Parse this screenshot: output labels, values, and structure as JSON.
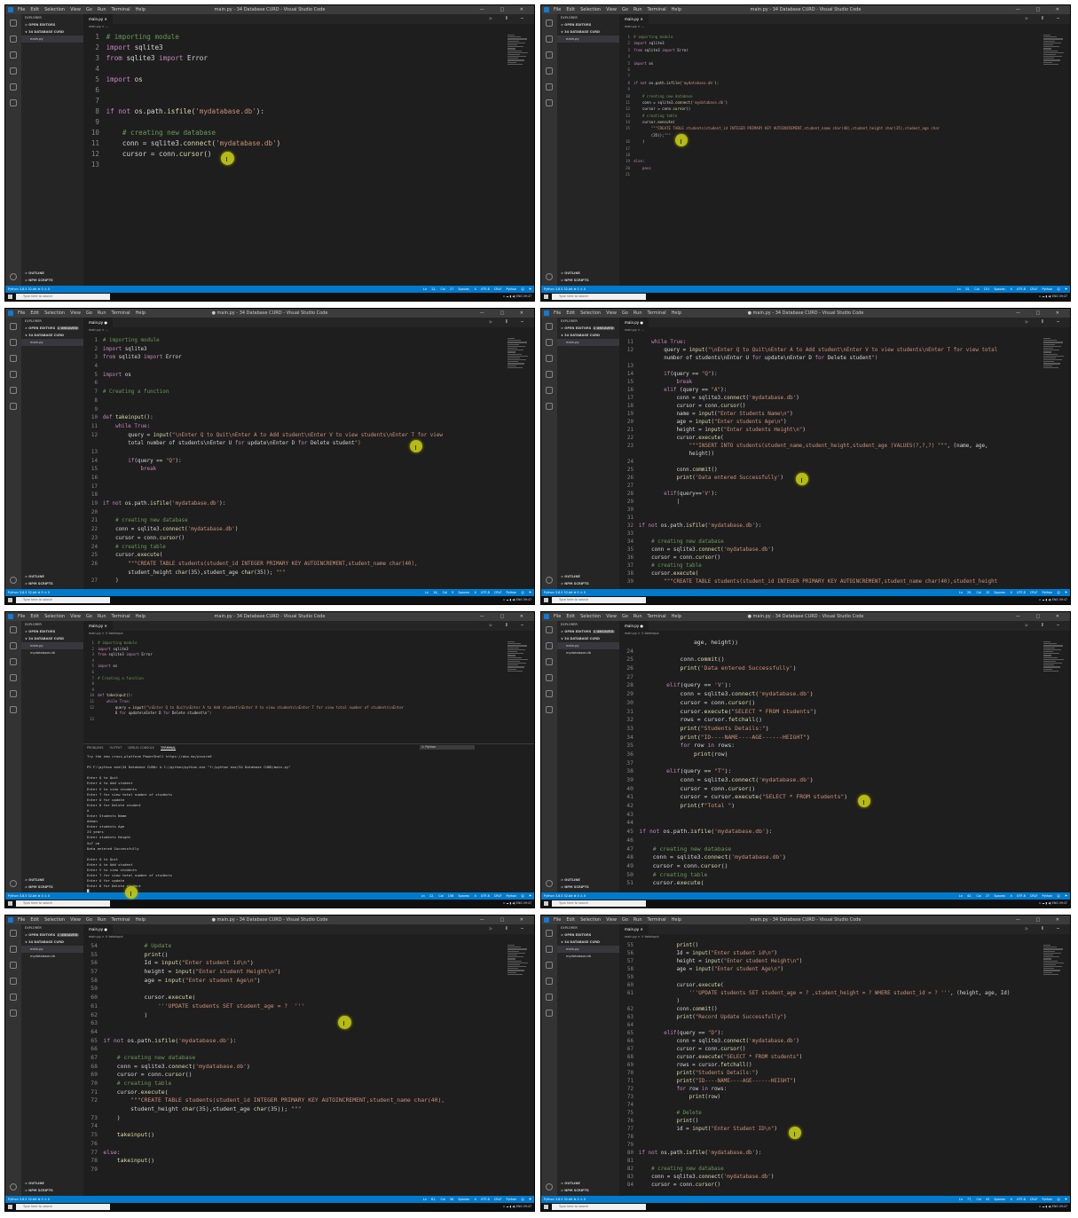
{
  "window": {
    "menu": [
      "File",
      "Edit",
      "Selection",
      "View",
      "Go",
      "Run",
      "Terminal",
      "Help"
    ],
    "title_saved": "main.py - 34 Database CURD - Visual Studio Code",
    "title_unsaved": "● main.py - 34 Database CURD - Visual Studio Code",
    "controls": "— □ ✕"
  },
  "sidebar": {
    "explorer": "EXPLORER",
    "open_editors": "> OPEN EDITORS",
    "unsaved_badge": "1 UNSAVED",
    "folder": "∨ 34 DATABASE CURD",
    "file_main": "main.py",
    "file_db": "mydatabase.db",
    "outline": "> OUTLINE",
    "npm": "> NPM SCRIPTS"
  },
  "tabs": {
    "main": "main.py",
    "crumb": "main.py > ...",
    "crumb_fn": "main.py > ⊙ takeinput"
  },
  "status": {
    "left": "Python 3.8.5 32-bit   ⊗ 0 ⚠ 0",
    "right_items": [
      "Ln 12, Col 27",
      "Ln 15, Col 151",
      "Ln 16, Col 9",
      "Ln 29, Col 15",
      "Ln 12, Col 156",
      "Ln 42, Col 27",
      "Ln 61, Col 56",
      "Ln 77, Col 43"
    ],
    "right_tail": "Spaces: 4  UTF-8  CRLF  Python  ☺ ⚑"
  },
  "taskbar": {
    "search": "Type here to search",
    "tray": "∧ ☁ ▮ ◀) ENG  09:47"
  },
  "terminal": {
    "tabs": [
      "PROBLEMS",
      "OUTPUT",
      "DEBUG CONSOLE",
      "TERMINAL"
    ],
    "selector": "1: Python",
    "output": [
      "Try the new cross-platform PowerShell https://aka.ms/pscore6",
      "",
      "PS F:\\python exe\\34 Database CURD> & C:/python/python.exe \"f:/python exe/34 Database CURD/main.py\"",
      "",
      "Enter Q to Quit",
      "Enter A to Add student",
      "Enter V to view students",
      "Enter T for view total number of students",
      "Enter U for update",
      "Enter D for Delete student",
      "A",
      "Enter Students Name",
      "Adnan",
      "Enter students Age",
      "23 years",
      "Enter students Height",
      "5x7 cm",
      "Data entered Successfully",
      "",
      "Enter Q to Quit",
      "Enter A to Add student",
      "Enter V to view students",
      "Enter T for view total number of students",
      "Enter U for update",
      "Enter D for Delete student",
      "█"
    ]
  },
  "panels": [
    {
      "lines": [
        {
          "n": "1",
          "t": "# importing module"
        },
        {
          "n": "2",
          "t": "import sqlite3"
        },
        {
          "n": "3",
          "t": "from sqlite3 import Error"
        },
        {
          "n": "4",
          "t": ""
        },
        {
          "n": "5",
          "t": "import os"
        },
        {
          "n": "6",
          "t": ""
        },
        {
          "n": "7",
          "t": ""
        },
        {
          "n": "8",
          "t": "if not os.path.isfile('mydatabase.db'):"
        },
        {
          "n": "9",
          "t": ""
        },
        {
          "n": "10",
          "t": "    # creating new database"
        },
        {
          "n": "11",
          "t": "    conn = sqlite3.connect('mydatabase.db')"
        },
        {
          "n": "12",
          "t": "    cursor = conn.cursor()"
        },
        {
          "n": "13",
          "t": ""
        }
      ]
    },
    {
      "lines": [
        {
          "n": "1",
          "t": "# importing module"
        },
        {
          "n": "2",
          "t": "import sqlite3"
        },
        {
          "n": "3",
          "t": "from sqlite3 import Error"
        },
        {
          "n": "4",
          "t": ""
        },
        {
          "n": "5",
          "t": "import os"
        },
        {
          "n": "6",
          "t": ""
        },
        {
          "n": "7",
          "t": ""
        },
        {
          "n": "8",
          "t": "if not os.path.isfile('mydatabase.db'):"
        },
        {
          "n": "9",
          "t": ""
        },
        {
          "n": "10",
          "t": "    # creating new database"
        },
        {
          "n": "11",
          "t": "    conn = sqlite3.connect('mydatabase.db')"
        },
        {
          "n": "12",
          "t": "    cursor = conn.cursor()"
        },
        {
          "n": "13",
          "t": "    # creating table"
        },
        {
          "n": "14",
          "t": "    cursor.execute("
        },
        {
          "n": "15",
          "t": "        \"\"\"CREATE TABLE students(student_id INTEGER PRIMARY KEY AUTOINCREMENT,student_name char(40),student_height char(35),student_age char"
        },
        {
          "n": "",
          "t": "        (35));\"\"\""
        },
        {
          "n": "16",
          "t": "    )"
        },
        {
          "n": "17",
          "t": ""
        },
        {
          "n": "18",
          "t": ""
        },
        {
          "n": "19",
          "t": "else:"
        },
        {
          "n": "20",
          "t": "    pass"
        },
        {
          "n": "21",
          "t": ""
        }
      ]
    },
    {
      "lines": [
        {
          "n": "1",
          "t": "# importing module"
        },
        {
          "n": "2",
          "t": "import sqlite3"
        },
        {
          "n": "3",
          "t": "from sqlite3 import Error"
        },
        {
          "n": "4",
          "t": ""
        },
        {
          "n": "5",
          "t": "import os"
        },
        {
          "n": "6",
          "t": ""
        },
        {
          "n": "7",
          "t": "# Creating a function"
        },
        {
          "n": "8",
          "t": ""
        },
        {
          "n": "9",
          "t": ""
        },
        {
          "n": "10",
          "t": "def takeinput():"
        },
        {
          "n": "11",
          "t": "    while True:"
        },
        {
          "n": "12",
          "t": "        query = input(\"\\nEnter Q to Quit\\nEnter A to Add student\\nEnter V to view students\\nEnter T for view"
        },
        {
          "n": "",
          "t": "        total number of students\\nEnter U for update\\nEnter D for Delete student\")"
        },
        {
          "n": "13",
          "t": ""
        },
        {
          "n": "14",
          "t": "        if(query == \"Q\"):"
        },
        {
          "n": "15",
          "t": "            break"
        },
        {
          "n": "16",
          "t": ""
        },
        {
          "n": "17",
          "t": ""
        },
        {
          "n": "18",
          "t": ""
        },
        {
          "n": "19",
          "t": "if not os.path.isfile('mydatabase.db'):"
        },
        {
          "n": "20",
          "t": ""
        },
        {
          "n": "21",
          "t": "    # creating new database"
        },
        {
          "n": "22",
          "t": "    conn = sqlite3.connect('mydatabase.db')"
        },
        {
          "n": "23",
          "t": "    cursor = conn.cursor()"
        },
        {
          "n": "24",
          "t": "    # creating table"
        },
        {
          "n": "25",
          "t": "    cursor.execute("
        },
        {
          "n": "26",
          "t": "        \"\"\"CREATE TABLE students(student_id INTEGER PRIMARY KEY AUTOINCREMENT,student_name char(40),"
        },
        {
          "n": "",
          "t": "        student_height char(35),student_age char(35)); \"\"\""
        },
        {
          "n": "27",
          "t": "    )"
        }
      ]
    },
    {
      "lines": [
        {
          "n": "11",
          "t": "    while True:"
        },
        {
          "n": "12",
          "t": "        query = input(\"\\nEnter Q to Quit\\nEnter A to Add student\\nEnter V to view students\\nEnter T for view total"
        },
        {
          "n": "",
          "t": "        number of students\\nEnter U for update\\nEnter D for Delete student\")"
        },
        {
          "n": "13",
          "t": ""
        },
        {
          "n": "14",
          "t": "        if(query == \"Q\"):"
        },
        {
          "n": "15",
          "t": "            break"
        },
        {
          "n": "16",
          "t": "        elif (query == \"A\"):"
        },
        {
          "n": "17",
          "t": "            conn = sqlite3.connect('mydatabase.db')"
        },
        {
          "n": "18",
          "t": "            cursor = conn.cursor()"
        },
        {
          "n": "19",
          "t": "            name = input(\"Enter Students Name\\n\")"
        },
        {
          "n": "20",
          "t": "            age = input(\"Enter students Age\\n\")"
        },
        {
          "n": "21",
          "t": "            height = input(\"Enter students Height\\n\")"
        },
        {
          "n": "22",
          "t": "            cursor.execute("
        },
        {
          "n": "23",
          "t": "                \"\"\"INSERT INTO students(student_name,student_height,student_age )VALUES(?,?,?) \"\"\", (name, age,"
        },
        {
          "n": "",
          "t": "                height))"
        },
        {
          "n": "24",
          "t": ""
        },
        {
          "n": "25",
          "t": "            conn.commit()"
        },
        {
          "n": "26",
          "t": "            print('Data entered Successfully')"
        },
        {
          "n": "27",
          "t": ""
        },
        {
          "n": "28",
          "t": "        elif(query=='V'):"
        },
        {
          "n": "29",
          "t": "            |"
        },
        {
          "n": "30",
          "t": ""
        },
        {
          "n": "31",
          "t": ""
        },
        {
          "n": "32",
          "t": "if not os.path.isfile('mydatabase.db'):"
        },
        {
          "n": "33",
          "t": ""
        },
        {
          "n": "34",
          "t": "    # creating new database"
        },
        {
          "n": "35",
          "t": "    conn = sqlite3.connect('mydatabase.db')"
        },
        {
          "n": "36",
          "t": "    cursor = conn.cursor()"
        },
        {
          "n": "37",
          "t": "    # creating table"
        },
        {
          "n": "38",
          "t": "    cursor.execute("
        },
        {
          "n": "39",
          "t": "        \"\"\"CREATE TABLE students(student_id INTEGER PRIMARY KEY AUTOINCREMENT,student_name char(40),student_height"
        }
      ]
    },
    {
      "lines": [
        {
          "n": "1",
          "t": "# importing module"
        },
        {
          "n": "2",
          "t": "import sqlite3"
        },
        {
          "n": "3",
          "t": "from sqlite3 import Error"
        },
        {
          "n": "4",
          "t": ""
        },
        {
          "n": "5",
          "t": "import os"
        },
        {
          "n": "6",
          "t": ""
        },
        {
          "n": "7",
          "t": "# Creating a function"
        },
        {
          "n": "8",
          "t": ""
        },
        {
          "n": "9",
          "t": ""
        },
        {
          "n": "10",
          "t": "def takeinput():"
        },
        {
          "n": "11",
          "t": "    while True:"
        },
        {
          "n": "12",
          "t": "        query = input(\"\\nEnter Q to Quit\\nEnter A to Add student\\nEnter V to view students\\nEnter T for view total number of students\\nEnter"
        },
        {
          "n": "",
          "t": "        U for update\\nEnter D for Delete student\\n\")"
        },
        {
          "n": "13",
          "t": ""
        }
      ]
    },
    {
      "lines": [
        {
          "n": "",
          "t": "                age, height))"
        },
        {
          "n": "24",
          "t": ""
        },
        {
          "n": "25",
          "t": "            conn.commit()"
        },
        {
          "n": "26",
          "t": "            print('Data entered Successfully')"
        },
        {
          "n": "27",
          "t": ""
        },
        {
          "n": "28",
          "t": "        elif(query == 'V'):"
        },
        {
          "n": "29",
          "t": "            conn = sqlite3.connect('mydatabase.db')"
        },
        {
          "n": "30",
          "t": "            cursor = conn.cursor()"
        },
        {
          "n": "31",
          "t": "            cursor.execute(\"SELECT * FROM students\")"
        },
        {
          "n": "32",
          "t": "            rows = cursor.fetchall()"
        },
        {
          "n": "33",
          "t": "            print(\"Students Details:\")"
        },
        {
          "n": "34",
          "t": "            print(\"ID----NAME----AGE------HEIGHT\")"
        },
        {
          "n": "35",
          "t": "            for row in rows:"
        },
        {
          "n": "36",
          "t": "                print(row)"
        },
        {
          "n": "37",
          "t": ""
        },
        {
          "n": "38",
          "t": "        elif(query == \"T\"):"
        },
        {
          "n": "39",
          "t": "            conn = sqlite3.connect('mydatabase.db')"
        },
        {
          "n": "40",
          "t": "            cursor = conn.cursor()"
        },
        {
          "n": "41",
          "t": "            cursor = cursor.execute(\"SELECT * FROM students\")"
        },
        {
          "n": "42",
          "t": "            print(f\"Total \")"
        },
        {
          "n": "43",
          "t": ""
        },
        {
          "n": "44",
          "t": ""
        },
        {
          "n": "45",
          "t": "if not os.path.isfile('mydatabase.db'):"
        },
        {
          "n": "46",
          "t": ""
        },
        {
          "n": "47",
          "t": "    # creating new database"
        },
        {
          "n": "48",
          "t": "    conn = sqlite3.connect('mydatabase.db')"
        },
        {
          "n": "49",
          "t": "    cursor = conn.cursor()"
        },
        {
          "n": "50",
          "t": "    # creating table"
        },
        {
          "n": "51",
          "t": "    cursor.execute("
        }
      ]
    },
    {
      "lines": [
        {
          "n": "54",
          "t": "            # Update"
        },
        {
          "n": "55",
          "t": "            print()"
        },
        {
          "n": "56",
          "t": "            Id = input(\"Enter student id\\n\")"
        },
        {
          "n": "57",
          "t": "            height = input(\"Enter student Height\\n\")"
        },
        {
          "n": "58",
          "t": "            age = input(\"Enter student Age\\n\")"
        },
        {
          "n": "59",
          "t": ""
        },
        {
          "n": "60",
          "t": "            cursor.execute("
        },
        {
          "n": "61",
          "t": "                '''UPDATE students SET student_age = ?  '''"
        },
        {
          "n": "62",
          "t": "            )"
        },
        {
          "n": "63",
          "t": ""
        },
        {
          "n": "64",
          "t": ""
        },
        {
          "n": "65",
          "t": "if not os.path.isfile('mydatabase.db'):"
        },
        {
          "n": "66",
          "t": ""
        },
        {
          "n": "67",
          "t": "    # creating new database"
        },
        {
          "n": "68",
          "t": "    conn = sqlite3.connect('mydatabase.db')"
        },
        {
          "n": "69",
          "t": "    cursor = conn.cursor()"
        },
        {
          "n": "70",
          "t": "    # creating table"
        },
        {
          "n": "71",
          "t": "    cursor.execute("
        },
        {
          "n": "72",
          "t": "        \"\"\"CREATE TABLE students(student_id INTEGER PRIMARY KEY AUTOINCREMENT,student_name char(40),"
        },
        {
          "n": "",
          "t": "        student_height char(35),student_age char(35)); \"\"\""
        },
        {
          "n": "73",
          "t": "    )"
        },
        {
          "n": "74",
          "t": ""
        },
        {
          "n": "75",
          "t": "    takeinput()"
        },
        {
          "n": "76",
          "t": ""
        },
        {
          "n": "77",
          "t": "else:"
        },
        {
          "n": "78",
          "t": "    takeinput()"
        },
        {
          "n": "79",
          "t": ""
        }
      ]
    },
    {
      "lines": [
        {
          "n": "55",
          "t": "            print()"
        },
        {
          "n": "56",
          "t": "            Id = input(\"Enter student id\\n\")"
        },
        {
          "n": "57",
          "t": "            height = input(\"Enter student Height\\n\")"
        },
        {
          "n": "58",
          "t": "            age = input(\"Enter student Age\\n\")"
        },
        {
          "n": "59",
          "t": ""
        },
        {
          "n": "60",
          "t": "            cursor.execute("
        },
        {
          "n": "61",
          "t": "                '''UPDATE students SET student_age = ? ,student_height = ? WHERE student_id = ? ''', (height, age, Id)"
        },
        {
          "n": "",
          "t": "            )"
        },
        {
          "n": "62",
          "t": "            conn.commit()"
        },
        {
          "n": "63",
          "t": "            print(\"Record Update Successfully\")"
        },
        {
          "n": "64",
          "t": ""
        },
        {
          "n": "65",
          "t": "        elif(query == \"D\"):"
        },
        {
          "n": "66",
          "t": "            conn = sqlite3.connect('mydatabase.db')"
        },
        {
          "n": "67",
          "t": "            cursor = conn.cursor()"
        },
        {
          "n": "68",
          "t": "            cursor.execute(\"SELECT * FROM students\")"
        },
        {
          "n": "69",
          "t": "            rows = cursor.fetchall()"
        },
        {
          "n": "70",
          "t": "            print(\"Students Details:\")"
        },
        {
          "n": "71",
          "t": "            print(\"ID----NAME----AGE------HEIGHT\")"
        },
        {
          "n": "72",
          "t": "            for row in rows:"
        },
        {
          "n": "73",
          "t": "                print(row)"
        },
        {
          "n": "74",
          "t": ""
        },
        {
          "n": "75",
          "t": "            # Delete"
        },
        {
          "n": "76",
          "t": "            print()"
        },
        {
          "n": "77",
          "t": "            id = input(\"Enter Student ID\\n\")"
        },
        {
          "n": "78",
          "t": ""
        },
        {
          "n": "79",
          "t": ""
        },
        {
          "n": "80",
          "t": "if not os.path.isfile('mydatabase.db'):"
        },
        {
          "n": "81",
          "t": ""
        },
        {
          "n": "82",
          "t": "    # creating new database"
        },
        {
          "n": "83",
          "t": "    conn = sqlite3.connect('mydatabase.db')"
        },
        {
          "n": "84",
          "t": "    cursor = conn.cursor()"
        }
      ]
    }
  ],
  "colors": {
    "editor_bg": "#1e1e1e",
    "sidebar_bg": "#252526",
    "activity_bg": "#333333",
    "statusbar_bg": "#007acc",
    "comment": "#6a9955",
    "keyword": "#c586c0",
    "string": "#ce9178",
    "function": "#dcdcaa",
    "text": "#d4d4d4",
    "cursor_highlight": "#c3c814"
  }
}
